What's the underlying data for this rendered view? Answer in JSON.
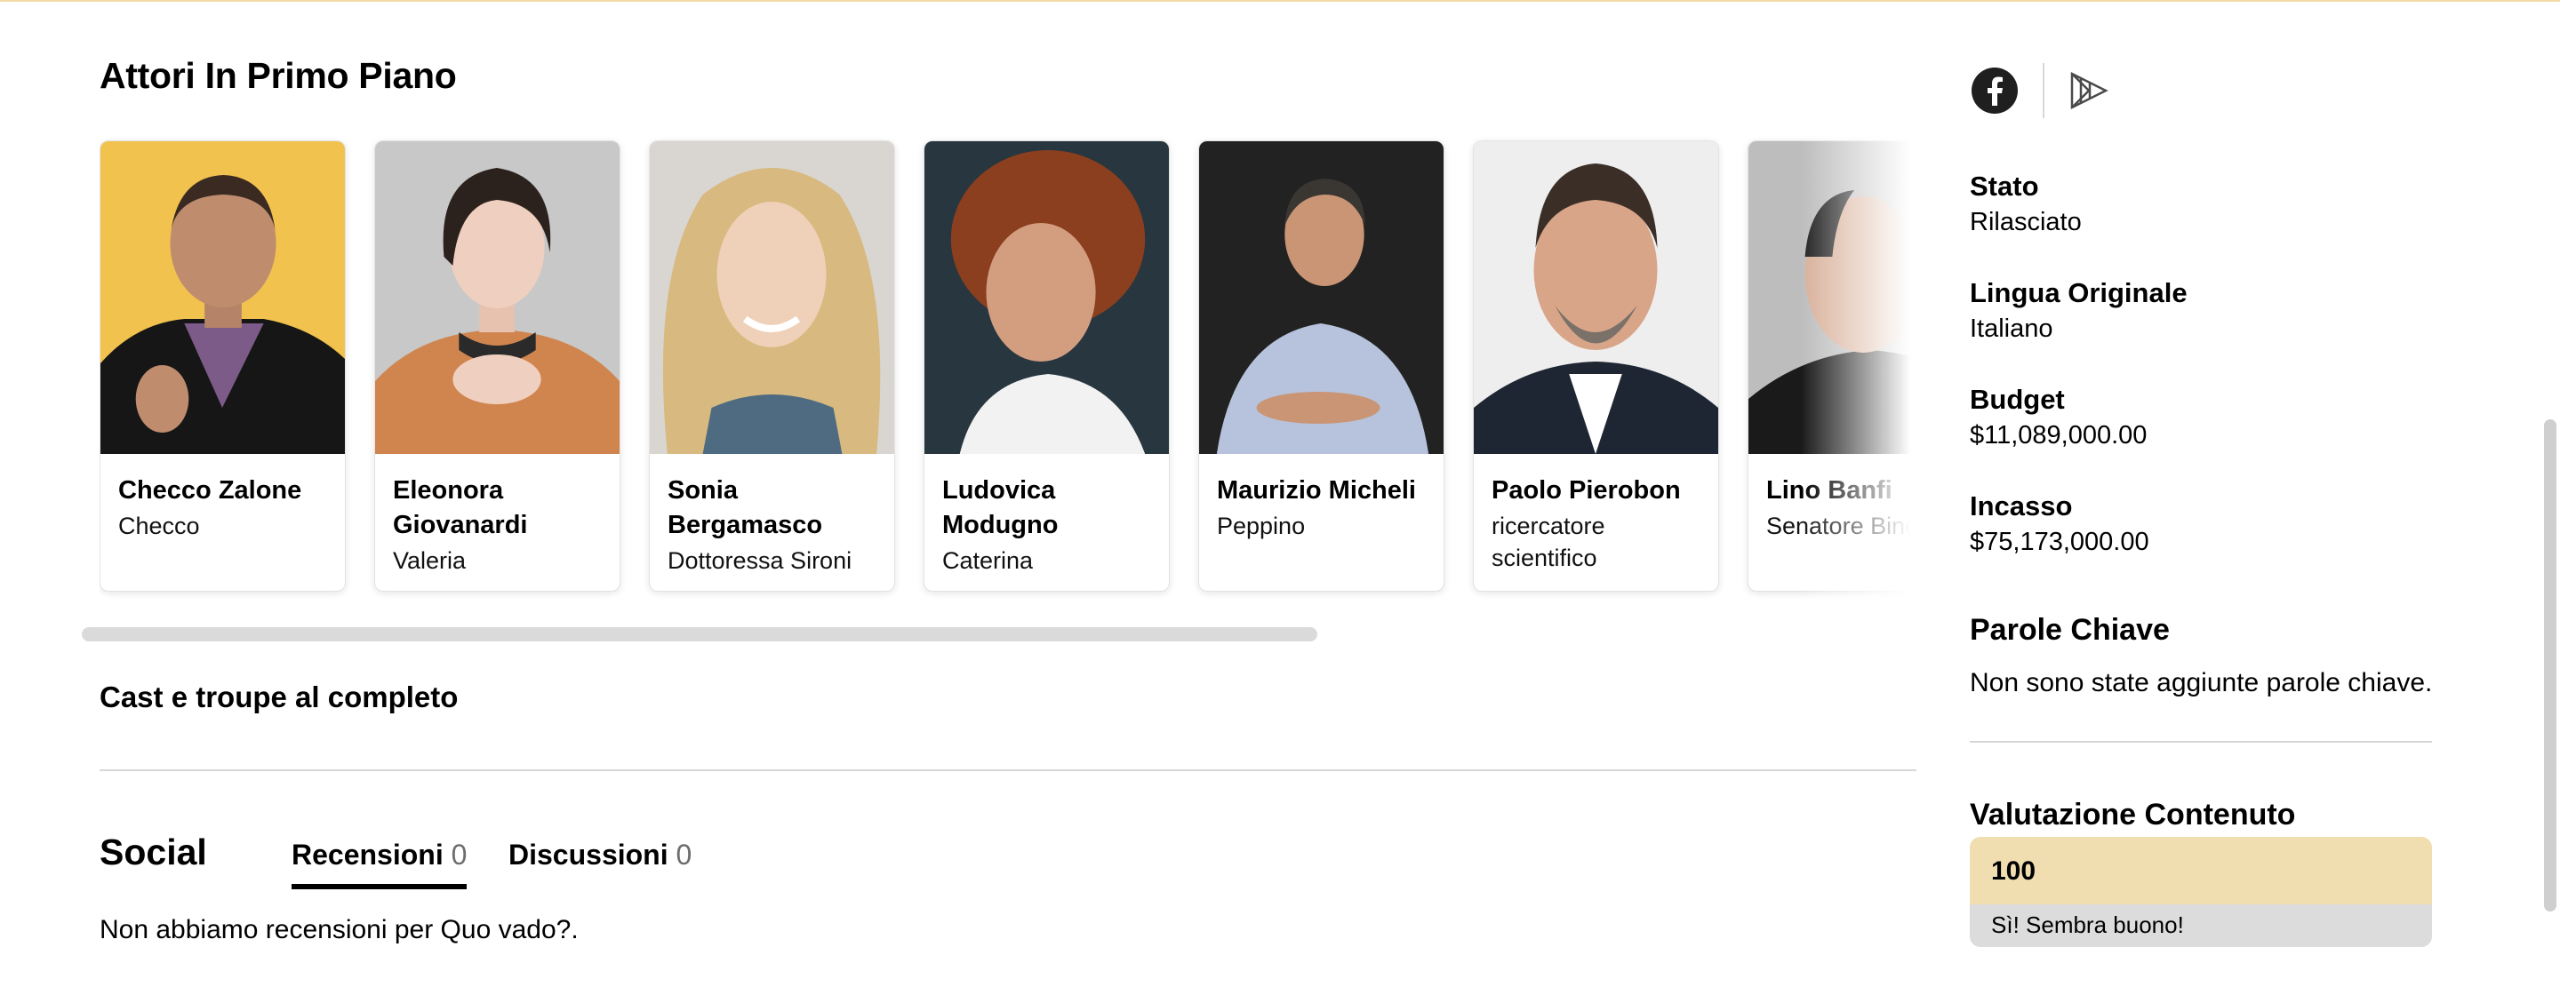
{
  "cast_section": {
    "title": "Attori In Primo Piano",
    "cards": [
      {
        "name": "Checco Zalone",
        "character": "Checco",
        "photo_icon": "actor-photo"
      },
      {
        "name": "Eleonora Giovanardi",
        "character": "Valeria",
        "photo_icon": "actor-photo"
      },
      {
        "name": "Sonia Bergamasco",
        "character": "Dottoressa Sironi",
        "photo_icon": "actor-photo"
      },
      {
        "name": "Ludovica Modugno",
        "character": "Caterina",
        "photo_icon": "actor-photo"
      },
      {
        "name": "Maurizio Micheli",
        "character": "Peppino",
        "photo_icon": "actor-photo"
      },
      {
        "name": "Paolo Pierobon",
        "character": "ricercatore scientifico",
        "photo_icon": "actor-photo"
      },
      {
        "name": "Lino Banfi",
        "character": "Senatore Binetto",
        "photo_icon": "actor-photo"
      }
    ],
    "full_cast_link": "Cast e troupe al completo"
  },
  "social": {
    "title": "Social",
    "tabs": [
      {
        "label": "Recensioni",
        "count": "0",
        "active": true
      },
      {
        "label": "Discussioni",
        "count": "0",
        "active": false
      }
    ],
    "empty_message": "Non abbiamo recensioni per Quo vado?."
  },
  "sidebar": {
    "icons": [
      "facebook-icon",
      "justwatch-icon"
    ],
    "facts": [
      {
        "label": "Stato",
        "value": "Rilasciato"
      },
      {
        "label": "Lingua Originale",
        "value": "Italiano"
      },
      {
        "label": "Budget",
        "value": "$11,089,000.00"
      },
      {
        "label": "Incasso",
        "value": "$75,173,000.00"
      }
    ],
    "keywords_title": "Parole Chiave",
    "keywords_text": "Non sono state aggiunte parole chiave.",
    "content_rating_title": "Valutazione Contenuto",
    "content_rating_value": "100",
    "content_rating_desc": "Sì! Sembra buono!"
  },
  "colors": {
    "accent_line": "#f3d9a6",
    "rating_value_bg": "#f1deb0",
    "rating_desc_bg": "#dcdcdc",
    "tab_count": "#6d6d6d"
  }
}
